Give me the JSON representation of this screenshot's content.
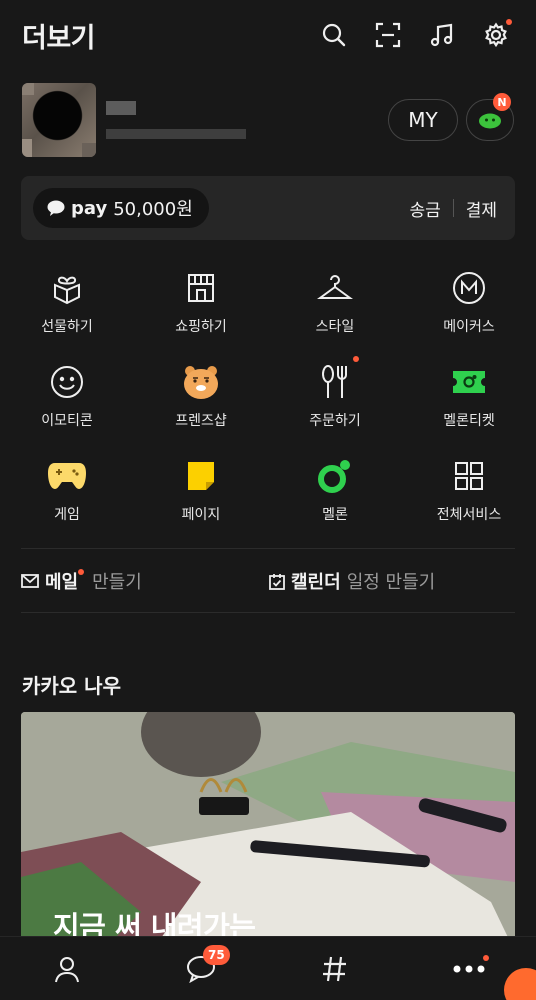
{
  "header": {
    "title": "더보기"
  },
  "profile": {
    "my_label": "MY",
    "char_badge": "N"
  },
  "pay": {
    "logo": "pay",
    "amount": "50,000원",
    "send_label": "송금",
    "pay_label": "결제"
  },
  "services": [
    {
      "label": "선물하기",
      "icon": "gift-icon"
    },
    {
      "label": "쇼핑하기",
      "icon": "shop-icon"
    },
    {
      "label": "스타일",
      "icon": "hanger-icon"
    },
    {
      "label": "메이커스",
      "icon": "makers-icon"
    },
    {
      "label": "이모티콘",
      "icon": "smiley-icon"
    },
    {
      "label": "프렌즈샵",
      "icon": "ryan-icon"
    },
    {
      "label": "주문하기",
      "icon": "fork-spoon-icon"
    },
    {
      "label": "멜론티켓",
      "icon": "ticket-icon"
    },
    {
      "label": "게임",
      "icon": "gamepad-icon"
    },
    {
      "label": "페이지",
      "icon": "page-icon"
    },
    {
      "label": "멜론",
      "icon": "melon-icon"
    },
    {
      "label": "전체서비스",
      "icon": "all-services-icon"
    }
  ],
  "mail": {
    "title": "메일",
    "action": "만들기"
  },
  "calendar": {
    "title": "캘린더",
    "action": "일정 만들기"
  },
  "now": {
    "title": "카카오 나우",
    "card_text": "지금 써 내려가는"
  },
  "tabs": {
    "chat_badge": "75"
  },
  "colors": {
    "accent_red": "#ff5b3a",
    "kakao_yellow": "#fee500",
    "melon_green": "#2fd04e"
  }
}
